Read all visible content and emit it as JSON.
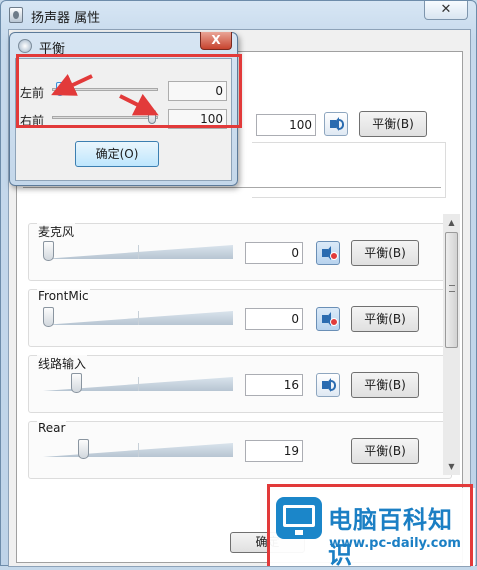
{
  "window": {
    "title": "扬声器 属性",
    "close_glyph": "✕"
  },
  "top_level": {
    "value": "100",
    "balance_label": "平衡(B)"
  },
  "channels": [
    {
      "label": "麦克风",
      "value": "0",
      "muted": true,
      "balance_label": "平衡(B)",
      "slider_level": 0.0
    },
    {
      "label": "FrontMic",
      "value": "0",
      "muted": true,
      "balance_label": "平衡(B)",
      "slider_level": 0.0
    },
    {
      "label": "线路输入",
      "value": "16",
      "muted": false,
      "balance_label": "平衡(B)",
      "slider_level": 0.16
    },
    {
      "label": "Rear",
      "value": "19",
      "muted": false,
      "balance_label": "平衡(B)",
      "slider_level": 0.19
    }
  ],
  "bottom": {
    "ok_label": "确定"
  },
  "balance_dialog": {
    "title": "平衡",
    "close_glyph": "X",
    "left_label": "左前",
    "left_value": "0",
    "right_label": "右前",
    "right_value": "100",
    "ok_label": "确定(O)"
  },
  "watermark": {
    "name": "电脑百科知识",
    "url": "www.pc-daily.com"
  },
  "colors": {
    "annotation_red": "#e23a3a",
    "brand_blue": "#1b7fc4"
  }
}
